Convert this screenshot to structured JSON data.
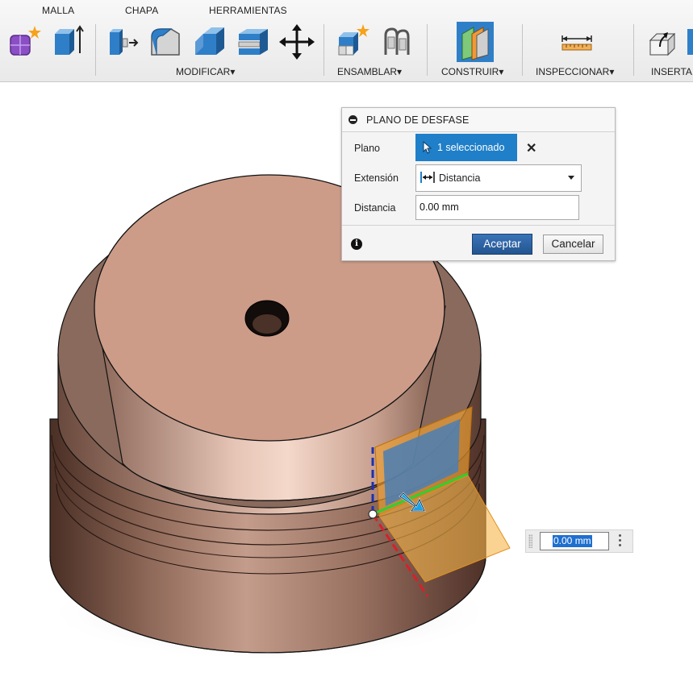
{
  "toolbar": {
    "tabs": [
      "MALLA",
      "CHAPA",
      "HERRAMIENTAS"
    ],
    "groups": {
      "modificar": "MODIFICAR",
      "ensamblar": "ENSAMBLAR",
      "construir": "CONSTRUIR",
      "inspeccionar": "INSPECCIONAR",
      "insertar": "INSERTA"
    },
    "dropdown_glyph": "▾",
    "icons": [
      "create-form-icon",
      "extrude-icon",
      "press-pull-icon",
      "fillet-icon",
      "chamfer-icon",
      "shell-icon",
      "move-icon",
      "new-component-icon",
      "joint-icon",
      "offset-plane-icon",
      "measure-icon",
      "insert-icon"
    ]
  },
  "dialog": {
    "title": "PLANO DE DESFASE",
    "plano_label": "Plano",
    "selection_text": "1 seleccionado",
    "extension_label": "Extensión",
    "extension_value": "Distancia",
    "distance_label": "Distancia",
    "distance_value": "0.00 mm",
    "ok_label": "Aceptar",
    "cancel_label": "Cancelar",
    "clear_glyph": "✕",
    "info_glyph": "i"
  },
  "viewport": {
    "distance_input_value": "0.00 mm"
  },
  "colors": {
    "accent": "#1f7fc8",
    "ok_button": "#2d64a8",
    "part_body": "#b88a78",
    "plane_orange": "#f0a030",
    "plane_blue": "#4a7fb5"
  }
}
